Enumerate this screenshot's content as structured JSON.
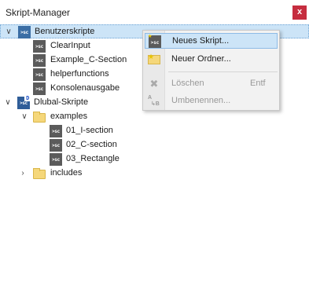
{
  "window": {
    "title": "Skript-Manager",
    "close_label": "x"
  },
  "tree": [
    {
      "label": "Benutzerskripte",
      "selected": true,
      "expanded": true,
      "icon": "user-scripts-icon"
    },
    {
      "label": "ClearInput",
      "icon": "script-icon"
    },
    {
      "label": "Example_C-Section",
      "icon": "script-icon"
    },
    {
      "label": "helperfunctions",
      "icon": "script-icon"
    },
    {
      "label": "Konsolenausgabe",
      "icon": "script-icon"
    },
    {
      "label": "Dlubal-Skripte",
      "expanded": true,
      "icon": "dlubal-scripts-icon"
    },
    {
      "label": "examples",
      "expanded": true,
      "icon": "folder-icon"
    },
    {
      "label": "01_I-section",
      "icon": "script-icon"
    },
    {
      "label": "02_C-section",
      "icon": "script-icon"
    },
    {
      "label": "03_Rectangle",
      "icon": "script-icon"
    },
    {
      "label": "includes",
      "expanded": false,
      "icon": "folder-icon"
    }
  ],
  "icon_text": {
    "sc": ">sc",
    "dlubal_badge": "D"
  },
  "context_menu": {
    "items": [
      {
        "label": "Neues Skript...",
        "icon": "new-script-icon",
        "highlighted": true,
        "enabled": true
      },
      {
        "label": "Neuer Ordner...",
        "icon": "new-folder-icon",
        "enabled": true
      },
      {
        "label": "Löschen",
        "shortcut": "Entf",
        "icon": "delete-icon",
        "enabled": false
      },
      {
        "label": "Umbenennen...",
        "icon": "rename-icon",
        "enabled": false
      }
    ]
  }
}
